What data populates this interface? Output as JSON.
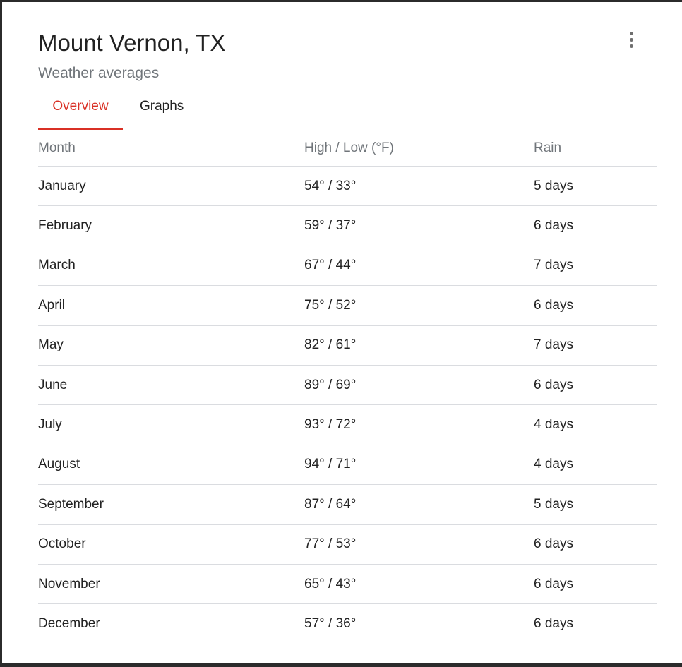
{
  "header": {
    "title": "Mount Vernon, TX",
    "subtitle": "Weather averages"
  },
  "tabs": [
    {
      "label": "Overview",
      "active": true
    },
    {
      "label": "Graphs",
      "active": false
    }
  ],
  "icons": {
    "more": "more-vert-icon"
  },
  "colors": {
    "accent": "#d93025"
  },
  "table": {
    "columns": [
      "Month",
      "High / Low (°F)",
      "Rain"
    ],
    "rows": [
      {
        "month": "January",
        "temp": "54° / 33°",
        "rain": "5 days"
      },
      {
        "month": "February",
        "temp": "59° / 37°",
        "rain": "6 days"
      },
      {
        "month": "March",
        "temp": "67° / 44°",
        "rain": "7 days"
      },
      {
        "month": "April",
        "temp": "75° / 52°",
        "rain": "6 days"
      },
      {
        "month": "May",
        "temp": "82° / 61°",
        "rain": "7 days"
      },
      {
        "month": "June",
        "temp": "89° / 69°",
        "rain": "6 days"
      },
      {
        "month": "July",
        "temp": "93° / 72°",
        "rain": "4 days"
      },
      {
        "month": "August",
        "temp": "94° / 71°",
        "rain": "4 days"
      },
      {
        "month": "September",
        "temp": "87° / 64°",
        "rain": "5 days"
      },
      {
        "month": "October",
        "temp": "77° / 53°",
        "rain": "6 days"
      },
      {
        "month": "November",
        "temp": "65° / 43°",
        "rain": "6 days"
      },
      {
        "month": "December",
        "temp": "57° / 36°",
        "rain": "6 days"
      }
    ]
  }
}
